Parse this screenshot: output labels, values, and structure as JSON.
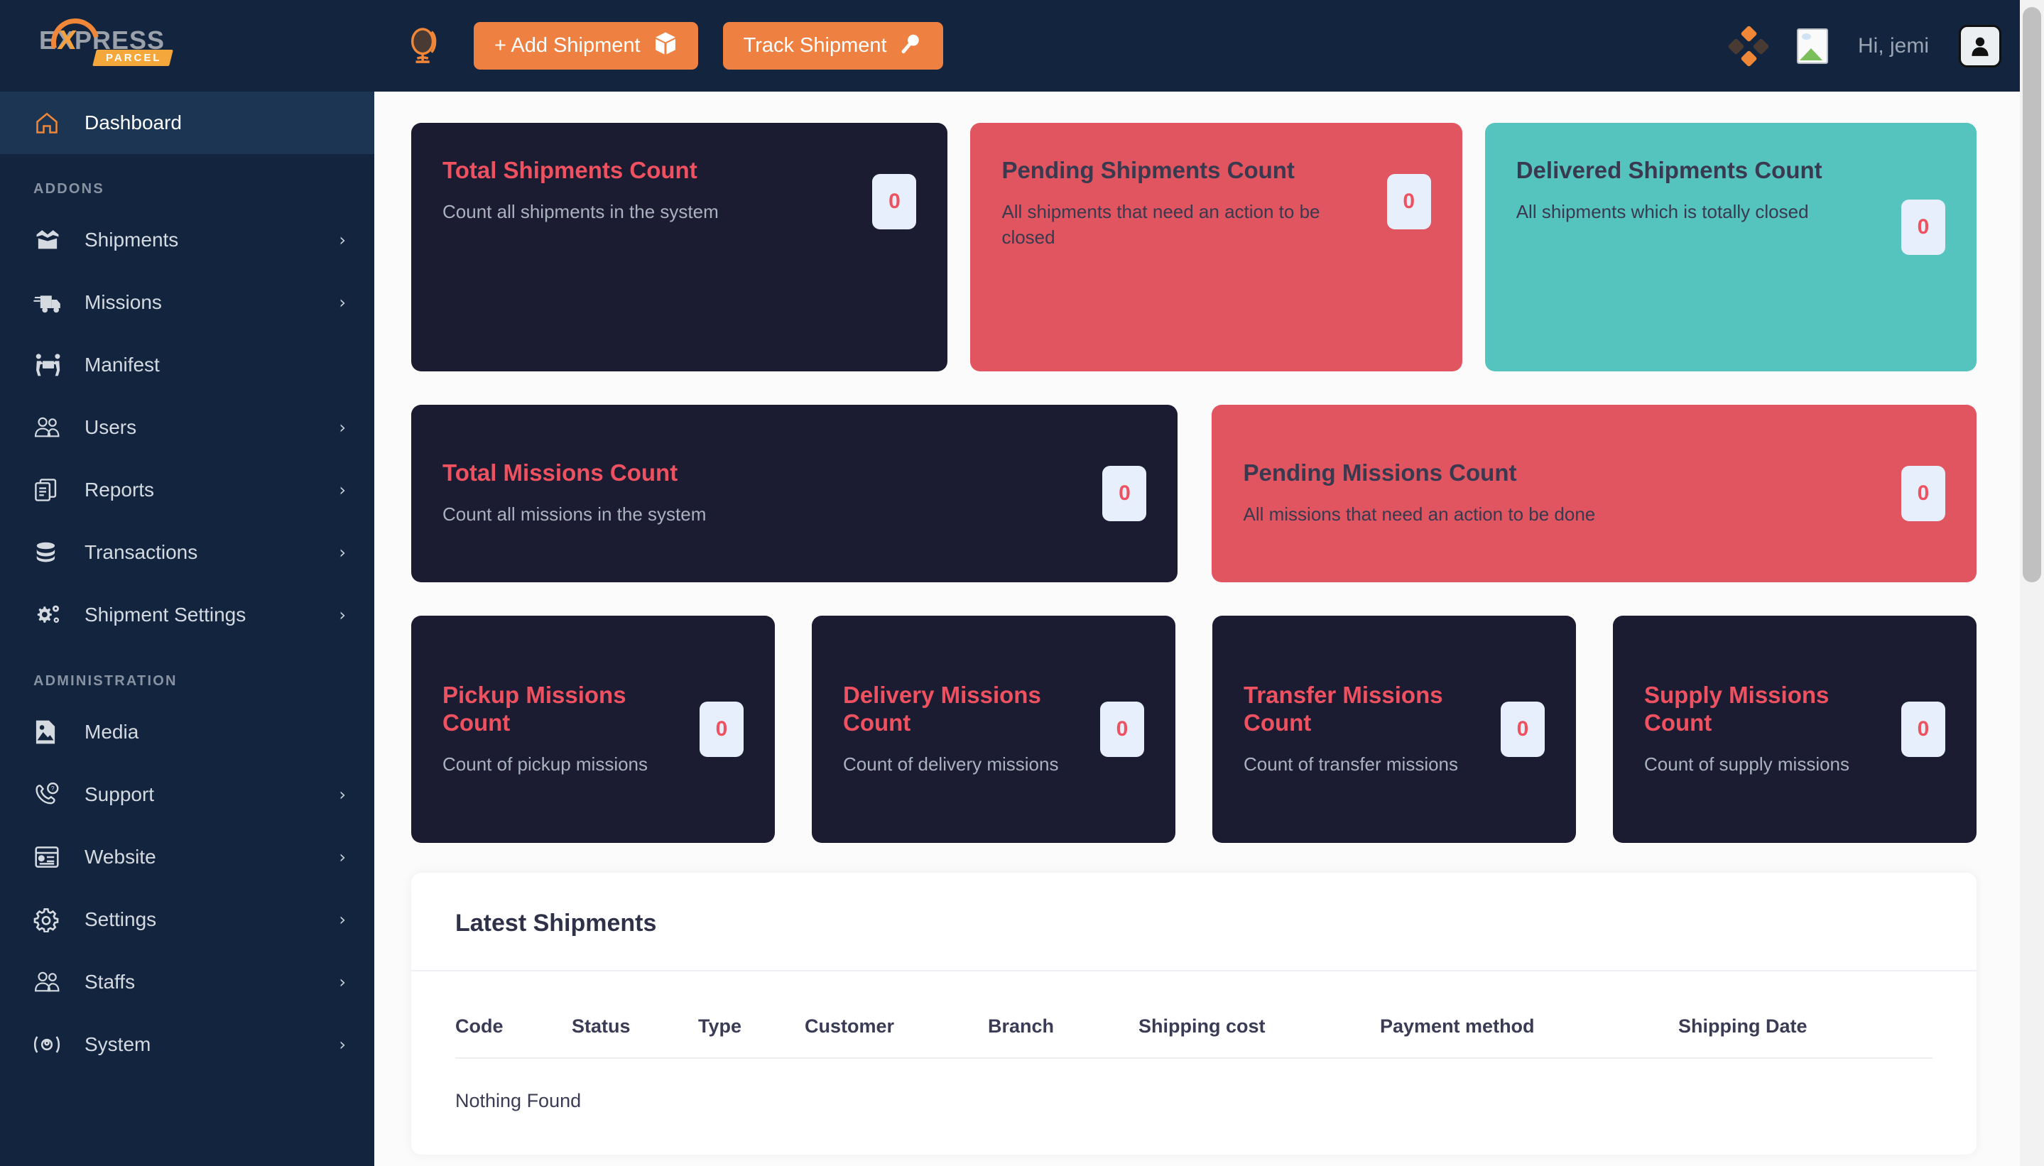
{
  "brand": {
    "logo_top": "EXPRESS",
    "logo_x": "X",
    "logo_badge": "PARCEL",
    "accent_orange": "#EE8141",
    "accent_red": "#EE5160",
    "accent_teal": "#55C4BE",
    "sidebar_bg": "#13253E",
    "card_dark_bg": "#1B1C32",
    "card_red_bg": "#E05560"
  },
  "header": {
    "globe_icon": "globe-icon",
    "add_shipment_label": "+ Add Shipment",
    "add_shipment_icon": "box-icon",
    "track_shipment_label": "Track Shipment",
    "track_shipment_icon": "search-icon",
    "apps_icon": "diamond-grid-icon",
    "image_icon": "broken-image-icon",
    "greeting": "Hi, jemi",
    "avatar_icon": "user-avatar-icon"
  },
  "sidebar": {
    "dashboard": {
      "label": "Dashboard",
      "icon": "home-icon",
      "active": true
    },
    "section_addons": "ADDONS",
    "addons": [
      {
        "label": "Shipments",
        "icon": "open-box-icon",
        "chevron": "›"
      },
      {
        "label": "Missions",
        "icon": "truck-icon",
        "chevron": "›"
      },
      {
        "label": "Manifest",
        "icon": "two-people-carry-icon",
        "chevron": ""
      },
      {
        "label": "Users",
        "icon": "users-icon",
        "chevron": "›"
      },
      {
        "label": "Reports",
        "icon": "documents-icon",
        "chevron": "›"
      },
      {
        "label": "Transactions",
        "icon": "coins-icon",
        "chevron": "›"
      },
      {
        "label": "Shipment Settings",
        "icon": "gears-icon",
        "chevron": "›"
      }
    ],
    "section_administration": "ADMINISTRATION",
    "administration": [
      {
        "label": "Media",
        "icon": "image-file-icon",
        "chevron": ""
      },
      {
        "label": "Support",
        "icon": "phone-question-icon",
        "chevron": "›"
      },
      {
        "label": "Website",
        "icon": "browser-window-icon",
        "chevron": "›"
      },
      {
        "label": "Settings",
        "icon": "gear-icon",
        "chevron": "›"
      },
      {
        "label": "Staffs",
        "icon": "staff-users-icon",
        "chevron": "›"
      },
      {
        "label": "System",
        "icon": "system-icon",
        "chevron": "›"
      }
    ]
  },
  "stats": {
    "row1": [
      {
        "title": "Total Shipments Count",
        "desc": "Count all shipments in the system",
        "value": "0",
        "style": "dark"
      },
      {
        "title": "Pending Shipments Count",
        "desc": "All shipments that need an action to be closed",
        "value": "0",
        "style": "red"
      },
      {
        "title": "Delivered Shipments Count",
        "desc": "All shipments which is totally closed",
        "value": "0",
        "style": "teal"
      }
    ],
    "row2": [
      {
        "title": "Total Missions Count",
        "desc": "Count all missions in the system",
        "value": "0",
        "style": "dark"
      },
      {
        "title": "Pending Missions Count",
        "desc": "All missions that need an action to be done",
        "value": "0",
        "style": "red"
      }
    ],
    "row3": [
      {
        "title": "Pickup Missions Count",
        "desc": "Count of pickup missions",
        "value": "0",
        "style": "dark"
      },
      {
        "title": "Delivery Missions Count",
        "desc": "Count of delivery missions",
        "value": "0",
        "style": "dark"
      },
      {
        "title": "Transfer Missions Count",
        "desc": "Count of transfer missions",
        "value": "0",
        "style": "dark"
      },
      {
        "title": "Supply Missions Count",
        "desc": "Count of supply missions",
        "value": "0",
        "style": "dark"
      }
    ]
  },
  "latest_shipments": {
    "title": "Latest Shipments",
    "columns": [
      "Code",
      "Status",
      "Type",
      "Customer",
      "Branch",
      "Shipping cost",
      "Payment method",
      "Shipping Date"
    ],
    "empty_message": "Nothing Found",
    "rows": []
  }
}
